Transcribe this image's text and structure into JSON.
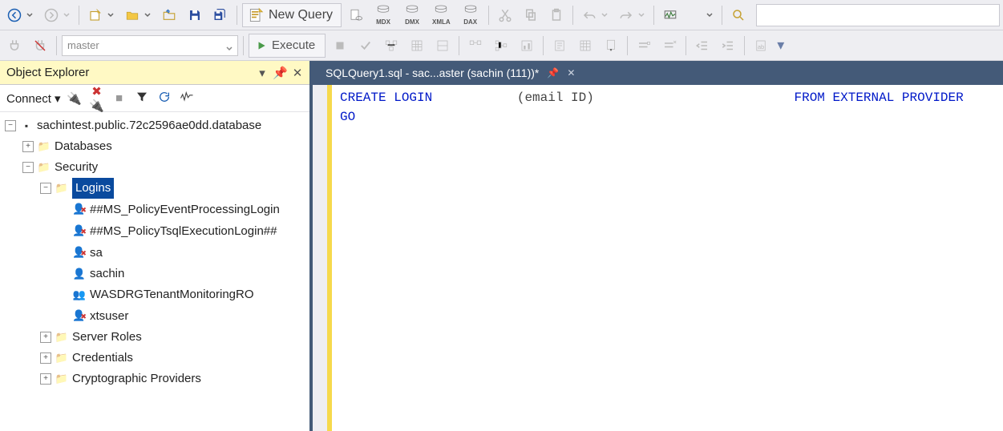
{
  "toolbar1": {
    "new_query": "New Query",
    "query_icons": [
      "MDX",
      "DMX",
      "XMLA",
      "DAX"
    ]
  },
  "toolbar2": {
    "db_combo": "master",
    "execute": "Execute"
  },
  "object_explorer": {
    "title": "Object Explorer",
    "connect_label": "Connect",
    "server": "sachintest.public.72c2596ae0dd.database",
    "nodes": {
      "databases": "Databases",
      "security": "Security",
      "logins": "Logins",
      "login_items": [
        "##MS_PolicyEventProcessingLogin",
        "##MS_PolicyTsqlExecutionLogin##",
        "sa",
        "sachin",
        "WASDRGTenantMonitoringRO",
        "xtsuser"
      ],
      "server_roles": "Server Roles",
      "credentials": "Credentials",
      "crypto": "Cryptographic Providers"
    }
  },
  "editor": {
    "tab_title": "SQLQuery1.sql - sac...aster (sachin (111))*",
    "code_line1a": "CREATE LOGIN",
    "code_line1_mid": "(email ID)",
    "code_line1b": "FROM EXTERNAL PROVIDER",
    "code_line2": "GO"
  }
}
